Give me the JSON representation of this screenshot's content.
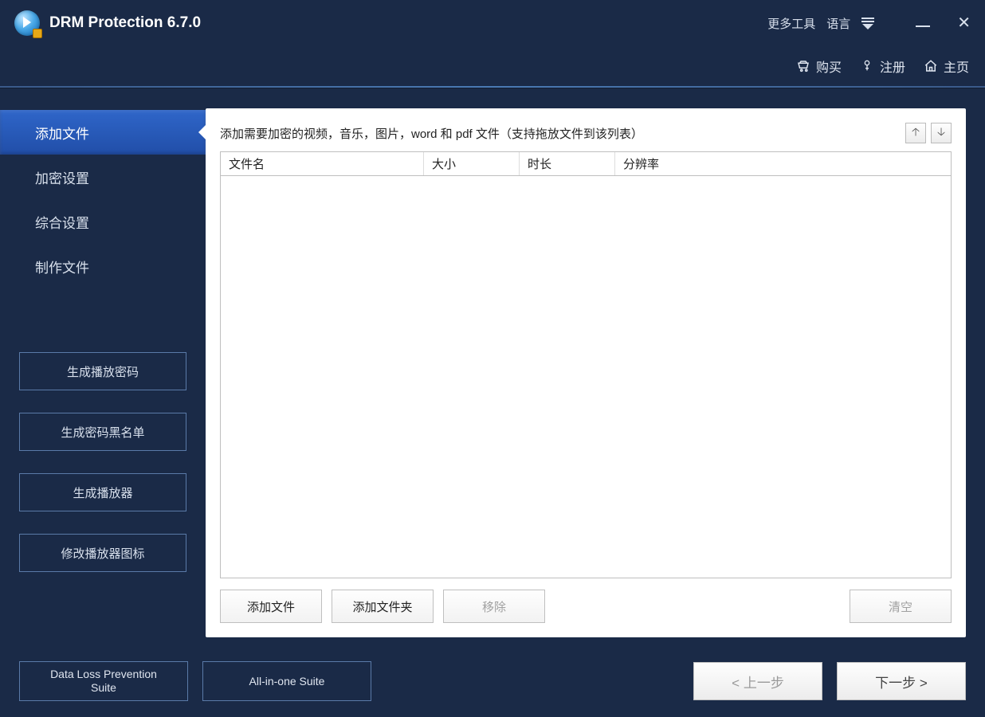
{
  "app": {
    "title": "DRM Protection 6.7.0"
  },
  "titlebar": {
    "more_tools": "更多工具",
    "language": "语言"
  },
  "toolbar": {
    "buy": "购买",
    "register": "注册",
    "home": "主页"
  },
  "sidebar": {
    "nav": [
      {
        "label": "添加文件",
        "active": true
      },
      {
        "label": "加密设置",
        "active": false
      },
      {
        "label": "综合设置",
        "active": false
      },
      {
        "label": "制作文件",
        "active": false
      }
    ],
    "buttons": {
      "gen_play_pw": "生成播放密码",
      "gen_blacklist": "生成密码黑名单",
      "gen_player": "生成播放器",
      "mod_player_icon": "修改播放器图标"
    }
  },
  "panel": {
    "instruction": "添加需要加密的视频，音乐，图片，word 和 pdf 文件（支持拖放文件到该列表）",
    "columns": {
      "filename": "文件名",
      "size": "大小",
      "duration": "时长",
      "resolution": "分辨率"
    },
    "actions": {
      "add_file": "添加文件",
      "add_folder": "添加文件夹",
      "remove": "移除",
      "clear": "清空"
    }
  },
  "bottom": {
    "dlp_suite": "Data Loss Prevention Suite",
    "aio_suite": "All-in-one Suite",
    "prev": "< 上一步",
    "next": "下一步 >"
  }
}
